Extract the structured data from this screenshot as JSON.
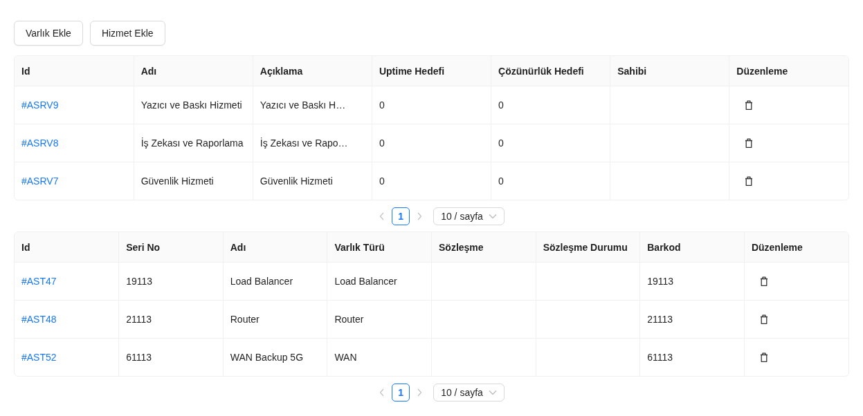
{
  "toolbar": {
    "buttons": [
      "Varlık Ekle",
      "Hizmet Ekle"
    ]
  },
  "tables": [
    {
      "columns": [
        {
          "label": "Id",
          "kind": "link"
        },
        {
          "label": "Adı",
          "kind": "text"
        },
        {
          "label": "Açıklama",
          "kind": "text"
        },
        {
          "label": "Uptime Hedefi",
          "kind": "text"
        },
        {
          "label": "Çözünürlük Hedefi",
          "kind": "text"
        },
        {
          "label": "Sahibi",
          "kind": "text"
        },
        {
          "label": "Düzenleme",
          "kind": "delete"
        }
      ],
      "rows": [
        [
          "#ASRV9",
          "Yazıcı ve Baskı Hizmeti",
          "Yazıcı ve Baskı H…",
          "0",
          "0",
          null
        ],
        [
          "#ASRV8",
          "İş Zekası ve Raporlama",
          "İş Zekası ve Rapo…",
          "0",
          "0",
          null
        ],
        [
          "#ASRV7",
          "Güvenlik Hizmeti",
          "Güvenlik Hizmeti",
          "0",
          "0",
          null
        ]
      ],
      "pagination": {
        "prev_disabled": true,
        "next_disabled": true,
        "pages": [
          {
            "label": "1",
            "selected": true
          }
        ],
        "page_size": "10 / sayfa"
      }
    },
    {
      "columns": [
        {
          "label": "Id",
          "kind": "link"
        },
        {
          "label": "Seri No",
          "kind": "text"
        },
        {
          "label": "Adı",
          "kind": "text"
        },
        {
          "label": "Varlık Türü",
          "kind": "text"
        },
        {
          "label": "Sözleşme",
          "kind": "text"
        },
        {
          "label": "Sözleşme Durumu",
          "kind": "text"
        },
        {
          "label": "Barkod",
          "kind": "text"
        },
        {
          "label": "Düzenleme",
          "kind": "delete"
        }
      ],
      "rows": [
        [
          "#AST47",
          "19113",
          "Load Balancer",
          "Load Balancer",
          null,
          null,
          "19113"
        ],
        [
          "#AST48",
          "21113",
          "Router",
          "Router",
          null,
          null,
          "21113"
        ],
        [
          "#AST52",
          "61113",
          "WAN Backup 5G",
          "WAN",
          null,
          null,
          "61113"
        ]
      ],
      "pagination": {
        "prev_disabled": true,
        "next_disabled": true,
        "pages": [
          {
            "label": "1",
            "selected": true
          }
        ],
        "page_size": "10 / sayfa"
      }
    }
  ]
}
